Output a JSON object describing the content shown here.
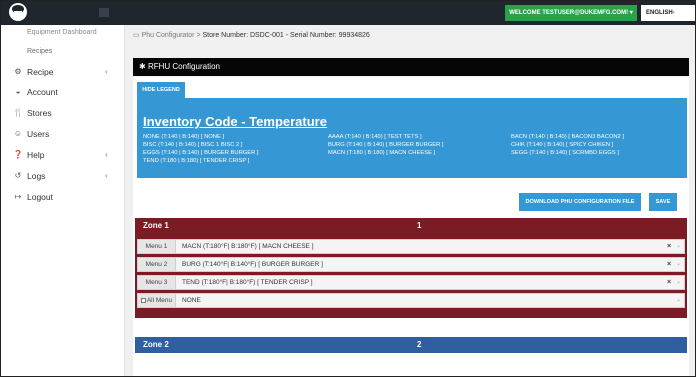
{
  "topbar": {
    "welcome": "WELCOME TESTUSER@DUKEMFG.COM! ▾",
    "language": "ENGLISH-"
  },
  "sidebar": {
    "sub_top": "Equipment Dashboard",
    "sub_recipes": "Recipes",
    "items": [
      {
        "label": "Recipe",
        "icon": "gear-icon",
        "glyph": "⚙",
        "chevron": "‹"
      },
      {
        "label": "Account",
        "icon": "account-icon",
        "glyph": "◒",
        "chevron": ""
      },
      {
        "label": "Stores",
        "icon": "stores-icon",
        "glyph": "🍴",
        "chevron": ""
      },
      {
        "label": "Users",
        "icon": "users-icon",
        "glyph": "☺",
        "chevron": ""
      },
      {
        "label": "Help",
        "icon": "help-icon",
        "glyph": "❓",
        "chevron": "‹"
      },
      {
        "label": "Logs",
        "icon": "logs-icon",
        "glyph": "↺",
        "chevron": "‹"
      },
      {
        "label": "Logout",
        "icon": "logout-icon",
        "glyph": "↦",
        "chevron": ""
      }
    ]
  },
  "breadcrumb": {
    "root": "Phu Configurator",
    "sep": ">",
    "current": "Store Number: DSDC-001 - Serial Number: 99934826"
  },
  "page_title": "RFHU Configuration",
  "hide_legend": "HIDE LEGEND",
  "legend": {
    "title": "Inventory Code - Temperature",
    "col1": [
      "NONE (T:140 | B:140) [ NONE ]",
      "BISC (T:140 | B:140) [ BISC 1 BISC 2 ]",
      "EGGS (T:140 | B:140) [ BURGER BURGER ]",
      "TEND (T:180 | B:180) [ TENDER CRISP ]"
    ],
    "col2": [
      "AAAA (T:140 | B:140) [ TEST TETS ]",
      "BURG (T:140 | B:140) [ BURGER BURGER ]",
      "MACN (T:180 | B:180) [ MACN CHEESE ]"
    ],
    "col3": [
      "BACN (T:140 | B:140) [ BACON3 BACON2 ]",
      "CHIK (T:140 | B:140) [ SPICY CHIKEN ]",
      "SEGG (T:140 | B:140) [ SCRMBD EGGS ]"
    ]
  },
  "actions": {
    "download": "DOWNLOAD PHU CONFIGURATION FILE",
    "save": "SAVE"
  },
  "zones": [
    {
      "name": "Zone 1",
      "number": "1",
      "menus": [
        {
          "label": "Menu 1",
          "value": "MACN (T:180°F| B:180°F) [ MACN CHEESE ]"
        },
        {
          "label": "Menu 2",
          "value": "BURG (T:140°F| B:140°F) [ BURGER BURGER ]"
        },
        {
          "label": "Menu 3",
          "value": "TEND (T:180°F| B:180°F) [ TENDER CRISP ]"
        }
      ],
      "all_menu": {
        "label": "All Menu",
        "value": "NONE"
      }
    },
    {
      "name": "Zone 2",
      "number": "2"
    }
  ],
  "colors": {
    "topbar": "#20262e",
    "accent_blue": "#3597d3",
    "welcome_green": "#2aa24a",
    "zone1": "#7b1c24",
    "zone2": "#2f5fa1"
  }
}
